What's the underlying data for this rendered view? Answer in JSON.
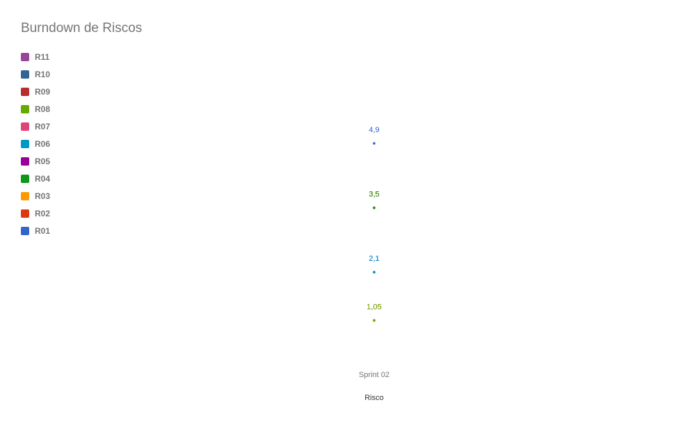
{
  "title": "Burndown de Riscos",
  "colors": {
    "title": "#757575",
    "legend_text": "#757575",
    "tick_text": "#757575",
    "xlabel_text": "#333333"
  },
  "chart_data": {
    "type": "scatter",
    "title": "Burndown de Riscos",
    "xlabel": "Risco",
    "ylabel": "",
    "categories": [
      "Sprint 02"
    ],
    "grid": false,
    "legend_position": "top-left",
    "legend_order": [
      "R11",
      "R10",
      "R09",
      "R08",
      "R07",
      "R06",
      "R05",
      "R04",
      "R03",
      "R02",
      "R01"
    ],
    "series": [
      {
        "name": "R01",
        "color": "#3366cc",
        "values": [
          4.9
        ],
        "label": "4,9"
      },
      {
        "name": "R02",
        "color": "#dc3912",
        "values": [
          3.5
        ],
        "label": "3,5"
      },
      {
        "name": "R03",
        "color": "#ff9900",
        "values": [
          3.5
        ],
        "label": "3,5"
      },
      {
        "name": "R04",
        "color": "#109618",
        "values": [
          3.5
        ],
        "label": "3,5"
      },
      {
        "name": "R05",
        "color": "#990099",
        "values": [
          2.1
        ],
        "label": "2,1"
      },
      {
        "name": "R06",
        "color": "#0099c6",
        "values": [
          2.1
        ],
        "label": "2,1"
      },
      {
        "name": "R07",
        "color": "#dd4477",
        "values": [
          1.05
        ],
        "label": "1,05"
      },
      {
        "name": "R08",
        "color": "#66aa00",
        "values": [
          1.05
        ],
        "label": "1,05"
      },
      {
        "name": "R09",
        "color": "#b82e2e",
        "values": [
          null
        ],
        "label": ""
      },
      {
        "name": "R10",
        "color": "#316395",
        "values": [
          null
        ],
        "label": ""
      },
      {
        "name": "R11",
        "color": "#994499",
        "values": [
          null
        ],
        "label": ""
      }
    ]
  }
}
